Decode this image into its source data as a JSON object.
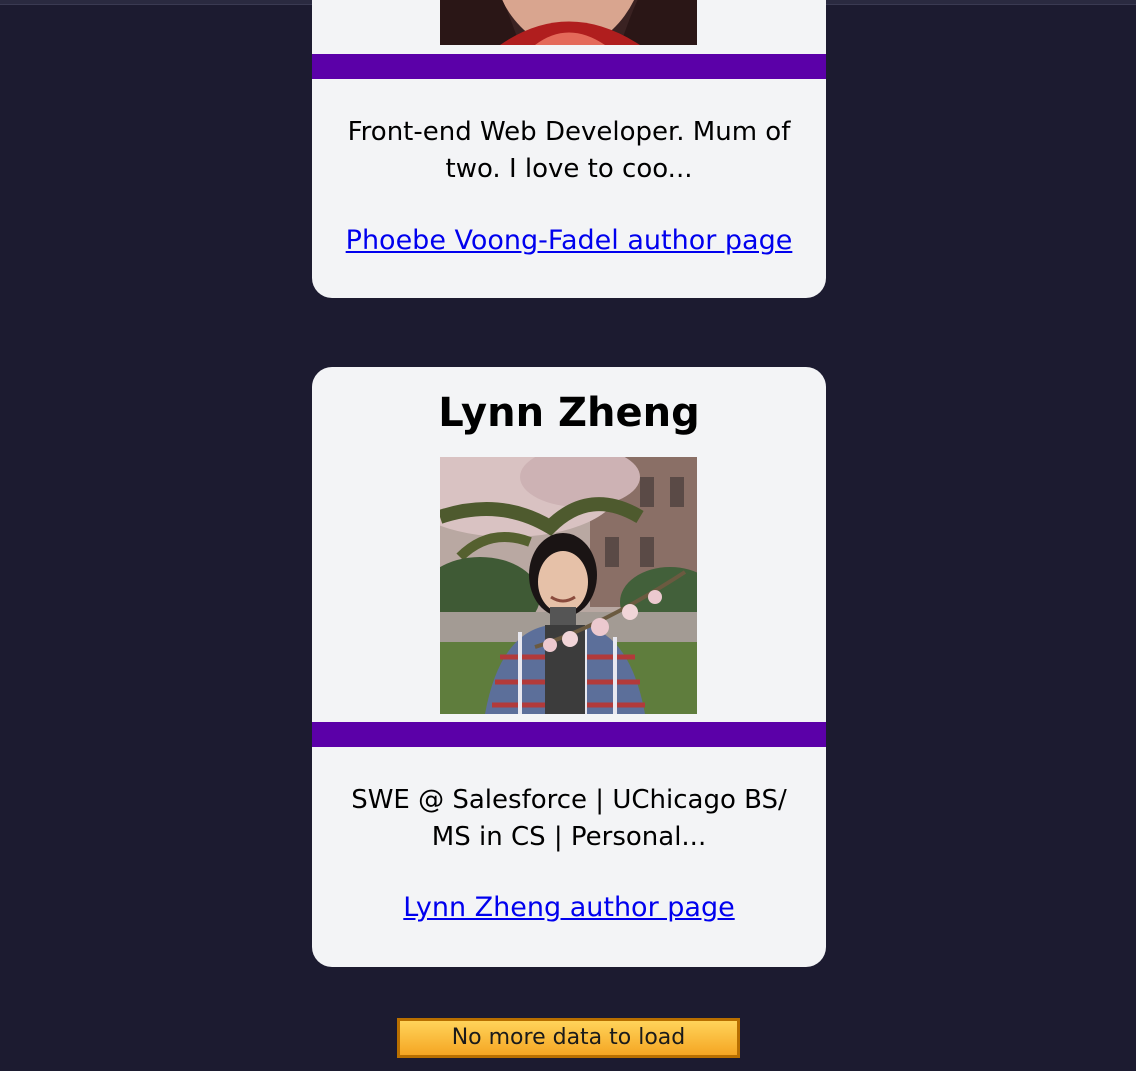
{
  "authors": [
    {
      "name": "",
      "bio": "Front-end Web Developer. Mum of two. I love to coo...",
      "link_label": "Phoebe Voong-Fadel author page"
    },
    {
      "name": "Lynn Zheng",
      "bio": "SWE @ Salesforce | UChicago BS/ MS in CS | Personal...",
      "link_label": "Lynn Zheng author page"
    }
  ],
  "load_more": {
    "label": "No more data to load"
  },
  "colors": {
    "background": "#1c1b30",
    "card": "#f3f4f6",
    "accent_band": "#5b00a8",
    "link": "#0000ee",
    "button": "#f5a623"
  }
}
